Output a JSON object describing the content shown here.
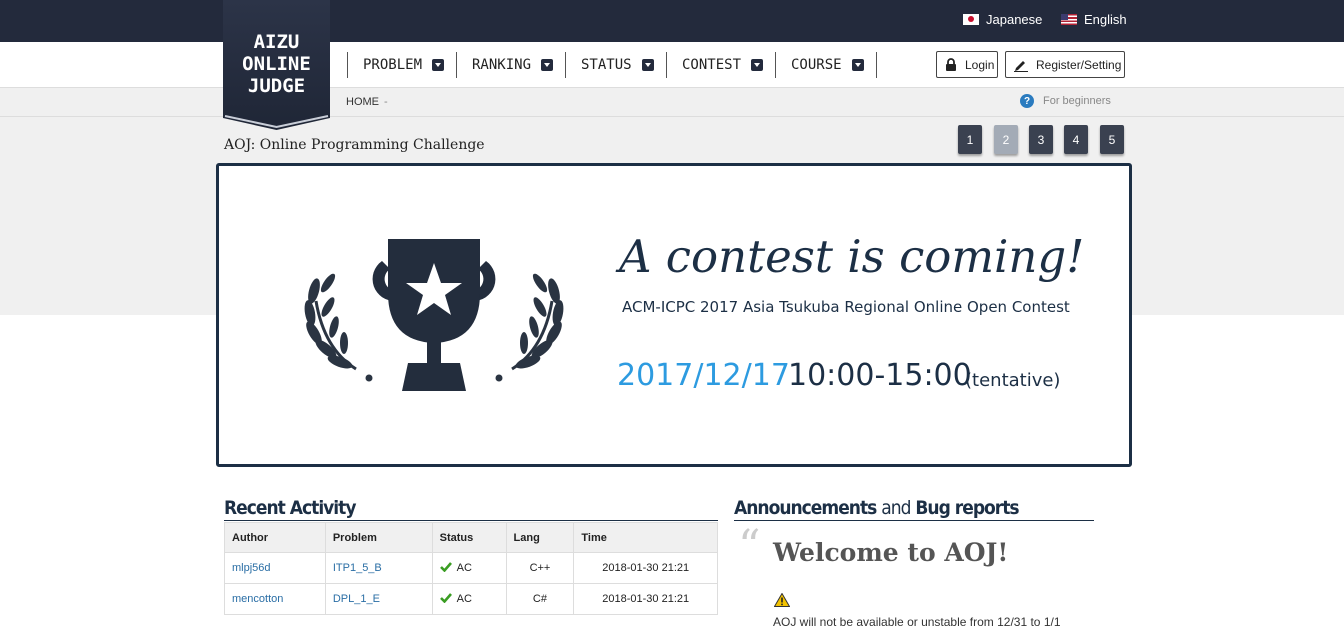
{
  "header": {
    "languages": [
      {
        "label": "Japanese",
        "flag": "jp"
      },
      {
        "label": "English",
        "flag": "us"
      }
    ],
    "logo": {
      "lines": [
        "AIZU",
        "ONLINE",
        "JUDGE"
      ]
    },
    "nav": [
      {
        "label": "PROBLEM"
      },
      {
        "label": "RANKING"
      },
      {
        "label": "STATUS"
      },
      {
        "label": "CONTEST"
      },
      {
        "label": "COURSE"
      }
    ],
    "login_label": "Login",
    "register_label": "Register/Setting"
  },
  "breadcrumb": {
    "home": "HOME",
    "separator": "-"
  },
  "beginners_label": "For beginners",
  "page_title": "AOJ: Online Programming Challenge",
  "pager": {
    "pages": [
      "1",
      "2",
      "3",
      "4",
      "5"
    ],
    "active": "2"
  },
  "banner": {
    "headline": "A contest is coming!",
    "subtitle": "ACM-ICPC 2017 Asia Tsukuba Regional Online Open Contest",
    "date": "2017/12/17",
    "time": "10:00-15:00",
    "note": "(tentative)"
  },
  "recent_activity": {
    "heading": "Recent Activity",
    "columns": [
      "Author",
      "Problem",
      "Status",
      "Lang",
      "Time"
    ],
    "rows": [
      {
        "author": "mlpj56d",
        "problem": "ITP1_5_B",
        "status": "AC",
        "lang": "C++",
        "time": "2018-01-30 21:21"
      },
      {
        "author": "mencotton",
        "problem": "DPL_1_E",
        "status": "AC",
        "lang": "C#",
        "time": "2018-01-30 21:21"
      }
    ]
  },
  "announcements": {
    "heading_part1": "Announcements",
    "heading_part2": "and",
    "heading_part3": "Bug reports",
    "quote_mark": "“",
    "title": "Welcome to AOJ!",
    "text": "AOJ will not be available or unstable from 12/31 to 1/1"
  },
  "colors": {
    "topbar": "#232a3c",
    "navy": "#1c2f45",
    "accent_blue": "#2d9be0",
    "link": "#2a6ea5"
  }
}
